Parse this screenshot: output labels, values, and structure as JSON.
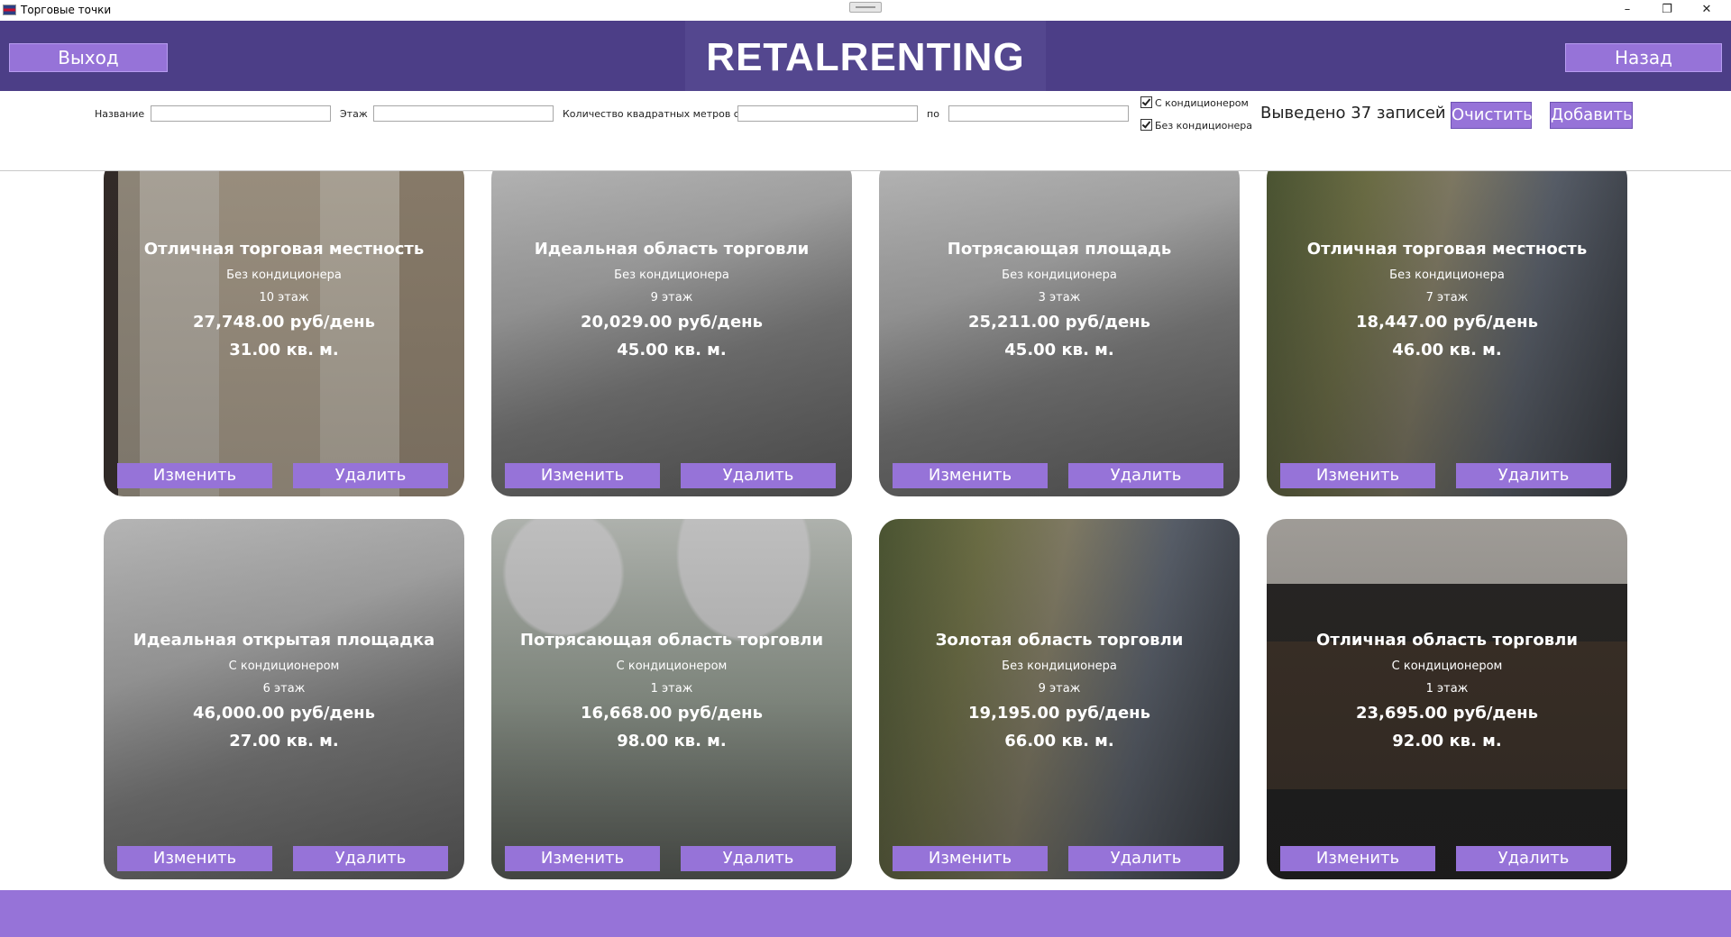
{
  "window": {
    "title": "Торговые точки",
    "min": "–",
    "max": "❐",
    "close": "✕"
  },
  "header": {
    "exit_label": "Выход",
    "back_label": "Назад",
    "logo_text": "RETALRENTING"
  },
  "filters": {
    "name_label": "Название",
    "name_value": "",
    "floor_label": "Этаж",
    "floor_value": "",
    "area_from_label": "Количество квадратных метров с",
    "area_from_value": "",
    "area_to_label": "по",
    "area_to_value": "",
    "with_ac_label": "С кондиционером",
    "with_ac_checked": true,
    "without_ac_label": "Без кондиционера",
    "without_ac_checked": true,
    "count_text": "Выведено 37 записей",
    "clear_label": "Очистить",
    "add_label": "Добавить"
  },
  "cards": [
    {
      "title": "Отличная торговая местность",
      "ac": "Без кондиционера",
      "floor": "10 этаж",
      "price": "27,748.00 руб/день",
      "area": "31.00 кв. м.",
      "edit_label": "Изменить",
      "delete_label": "Удалить",
      "photo": "boutique"
    },
    {
      "title": "Идеальная область торговли",
      "ac": "Без кондиционера",
      "floor": "9 этаж",
      "price": "20,029.00 руб/день",
      "area": "45.00 кв. м.",
      "edit_label": "Изменить",
      "delete_label": "Удалить",
      "photo": "mall"
    },
    {
      "title": "Потрясающая площадь",
      "ac": "Без кондиционера",
      "floor": "3 этаж",
      "price": "25,211.00 руб/день",
      "area": "45.00 кв. м.",
      "edit_label": "Изменить",
      "delete_label": "Удалить",
      "photo": "mall"
    },
    {
      "title": "Отличная торговая местность",
      "ac": "Без кондиционера",
      "floor": "7 этаж",
      "price": "18,447.00 руб/день",
      "area": "46.00 кв. м.",
      "edit_label": "Изменить",
      "delete_label": "Удалить",
      "photo": "street"
    },
    {
      "title": "Идеальная открытая площадка",
      "ac": "С кондиционером",
      "floor": "6 этаж",
      "price": "46,000.00 руб/день",
      "area": "27.00 кв. м.",
      "edit_label": "Изменить",
      "delete_label": "Удалить",
      "photo": "mall"
    },
    {
      "title": "Потрясающая область торговли",
      "ac": "С кондиционером",
      "floor": "1 этаж",
      "price": "16,668.00 руб/день",
      "area": "98.00 кв. м.",
      "edit_label": "Изменить",
      "delete_label": "Удалить",
      "photo": "office"
    },
    {
      "title": "Золотая область торговли",
      "ac": "Без кондиционера",
      "floor": "9 этаж",
      "price": "19,195.00 руб/день",
      "area": "66.00 кв. м.",
      "edit_label": "Изменить",
      "delete_label": "Удалить",
      "photo": "street"
    },
    {
      "title": "Отличная область торговли",
      "ac": "С кондиционером",
      "floor": "1 этаж",
      "price": "23,695.00 руб/день",
      "area": "92.00 кв. м.",
      "edit_label": "Изменить",
      "delete_label": "Удалить",
      "photo": "prada"
    }
  ]
}
